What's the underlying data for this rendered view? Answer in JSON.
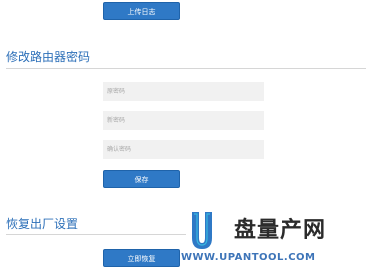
{
  "log": {
    "upload_button": "上传日志"
  },
  "password_section": {
    "title": "修改路由器密码",
    "old_password_placeholder": "原密码",
    "new_password_placeholder": "新密码",
    "confirm_password_placeholder": "确认密码",
    "save_button": "保存"
  },
  "factory_reset_section": {
    "title": "恢复出厂设置",
    "reset_button": "立即恢复"
  },
  "watermark": {
    "brand_text": "盘量产网",
    "url_text": "WWW.UPANTOOL.COM",
    "colors": {
      "u_blue": "#2f79c6",
      "u_cyan": "#38b8e0"
    }
  },
  "colors": {
    "accent": "#2f79c6",
    "section_title": "#2c6fb8",
    "input_bg": "#f1f1f1",
    "divider": "#d6d6d6"
  }
}
